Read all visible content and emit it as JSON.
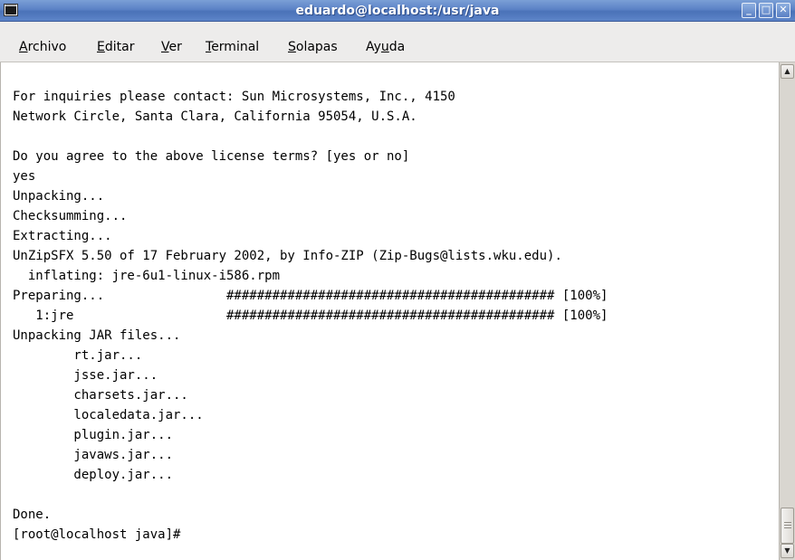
{
  "window": {
    "title": "eduardo@localhost:/usr/java",
    "app_icon": "terminal-icon",
    "controls": {
      "minimize": "_",
      "maximize": "□",
      "close": "✕"
    },
    "colors": {
      "titlebar": "#5b82c6",
      "menubar": "#edeceb",
      "terminal_bg": "#ffffff",
      "terminal_fg": "#000000"
    }
  },
  "menubar": {
    "items": [
      {
        "mnemonic": "A",
        "rest": "rchivo"
      },
      {
        "mnemonic": "E",
        "rest": "ditar"
      },
      {
        "mnemonic": "V",
        "rest": "er"
      },
      {
        "mnemonic": "T",
        "rest": "erminal"
      },
      {
        "mnemonic": "S",
        "rest": "olapas"
      },
      {
        "pre": "Ay",
        "mnemonic": "u",
        "rest": "da"
      }
    ]
  },
  "terminal": {
    "lines": [
      "For inquiries please contact: Sun Microsystems, Inc., 4150",
      "Network Circle, Santa Clara, California 95054, U.S.A.",
      "",
      "Do you agree to the above license terms? [yes or no]",
      "yes",
      "Unpacking...",
      "Checksumming...",
      "Extracting...",
      "UnZipSFX 5.50 of 17 February 2002, by Info-ZIP (Zip-Bugs@lists.wku.edu).",
      "  inflating: jre-6u1-linux-i586.rpm",
      "Preparing...                ########################################### [100%]",
      "   1:jre                    ########################################### [100%]",
      "Unpacking JAR files...",
      "        rt.jar...",
      "        jsse.jar...",
      "        charsets.jar...",
      "        localedata.jar...",
      "        plugin.jar...",
      "        javaws.jar...",
      "        deploy.jar...",
      "",
      "Done.",
      "[root@localhost java]#"
    ]
  },
  "scrollbar": {
    "up_arrow": "▲",
    "down_arrow": "▼",
    "position": 1.0
  }
}
